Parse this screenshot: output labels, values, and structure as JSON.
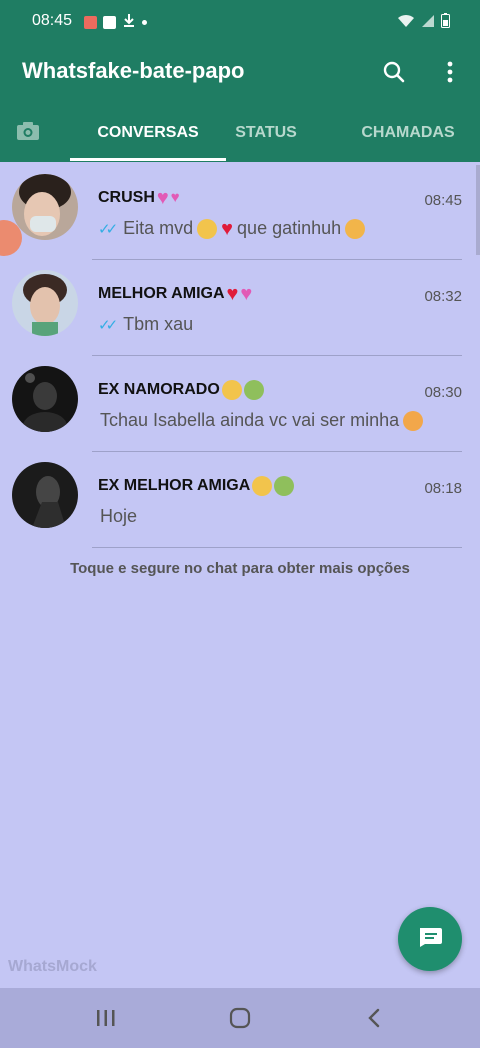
{
  "status_bar": {
    "time": "08:45",
    "left_icons": [
      "image-icon",
      "youtube-icon",
      "download-icon",
      "dot-icon"
    ],
    "right_icons": [
      "wifi-icon",
      "signal-icon",
      "battery-icon"
    ]
  },
  "app": {
    "title": "Whatsfake-bate-papo",
    "search_icon": "search-icon",
    "menu_icon": "more-vertical-icon",
    "accent_color": "#1f7d63",
    "background_color": "#c4c6f4"
  },
  "tabs": [
    {
      "label": "",
      "icon": "camera-icon"
    },
    {
      "label": "CONVERSAS",
      "active": true
    },
    {
      "label": "STATUS"
    },
    {
      "label": "CHAMADAS"
    }
  ],
  "chats": [
    {
      "name": "CRUSH",
      "time": "08:45",
      "message": "Eita mvd",
      "message_tail": "que gatinhuh",
      "read_ticks": true
    },
    {
      "name": "MELHOR AMIGA",
      "time": "08:32",
      "message": "Tbm xau",
      "read_ticks": true
    },
    {
      "name": "EX NAMORADO",
      "time": "08:30",
      "message": "Tchau Isabella ainda vc vai ser minha",
      "read_ticks": false
    },
    {
      "name": "EX MELHOR AMIGA",
      "time": "08:18",
      "message": "Hoje",
      "read_ticks": false
    }
  ],
  "hint": "Toque e segure no chat para obter mais opções",
  "watermark": "WhatsMock",
  "fab_icon": "new-chat-icon",
  "nav": [
    "recent-apps-icon",
    "home-icon",
    "back-icon"
  ]
}
